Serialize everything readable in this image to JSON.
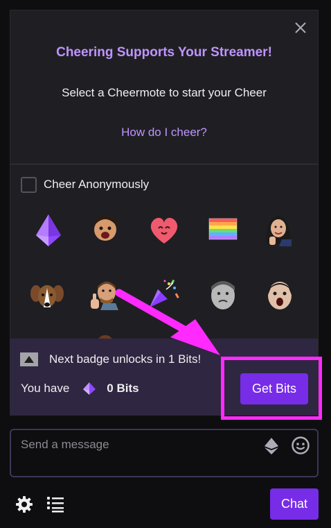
{
  "popover": {
    "title": "Cheering Supports Your Streamer!",
    "subtitle": "Select a Cheermote to start your Cheer",
    "help_link": "How do I cheer?",
    "anonymous_label": "Cheer Anonymously",
    "anonymous_checked": false
  },
  "cheermotes": [
    "bits-gem",
    "streamer-face",
    "heart",
    "rainbow-flag",
    "streamer-wave",
    "dog",
    "thumbs-up-streamer",
    "party-popper",
    "grey-face",
    "shouting-face"
  ],
  "footer": {
    "badge_text": "Next badge unlocks in 1 Bits!",
    "have_prefix": "You have",
    "bits_amount": "0 Bits",
    "get_bits_label": "Get Bits"
  },
  "chat": {
    "placeholder": "Send a message",
    "chat_button_label": "Chat"
  },
  "colors": {
    "accent": "#772ce8",
    "accent_light": "#bf94ff",
    "highlight": "#ff2aff",
    "footer_bg": "#2f2641",
    "panel_bg": "#1f1f23"
  }
}
